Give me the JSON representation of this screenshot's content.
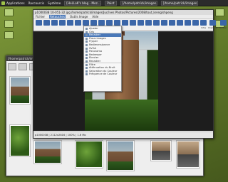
{
  "panel": {
    "items": [
      "Applications",
      "Raccourcis",
      "Système"
    ],
    "tasks": [
      "[HeLLoK's blog - Moz...",
      "Paint",
      "[/home/patrick/images...",
      "[/home/patrick/images..."
    ]
  },
  "desktop": {
    "icons": [
      "",
      "",
      "",
      "",
      ""
    ]
  },
  "back_window": {
    "title": "[/home/patrick/images..."
  },
  "main_window": {
    "title": "p1000038 10-051-32 jpg /home/patrick/images/Juc/ives Photos/Pictures/2008/tout_kreng/shpeng",
    "menus": [
      "Fichier",
      "Retouches",
      "Outils Image",
      "Aide"
    ],
    "toolbar": [
      "",
      "",
      "",
      "",
      "",
      "",
      "",
      "",
      "",
      "",
      "",
      "",
      "",
      "",
      "",
      "",
      "",
      "",
      "",
      "",
      "",
      "Infos",
      "Imprimer",
      "Quitter"
    ],
    "status": "p1000038 | 2112x2816 | 100% | 1.6 Mo"
  },
  "menu": {
    "items": [
      "Ajuster",
      "Gris",
      "Recadrer",
      "Flous images",
      "Flyiper",
      "Redimensionner",
      "SVGA",
      "Panorama",
      "Redresser",
      "Ebruter",
      "Recadrer",
      "Filtre",
      "Atténuation du Bruit",
      "Saturation du Couleur",
      "Fréquence de Couleur"
    ],
    "selected_index": 2
  }
}
